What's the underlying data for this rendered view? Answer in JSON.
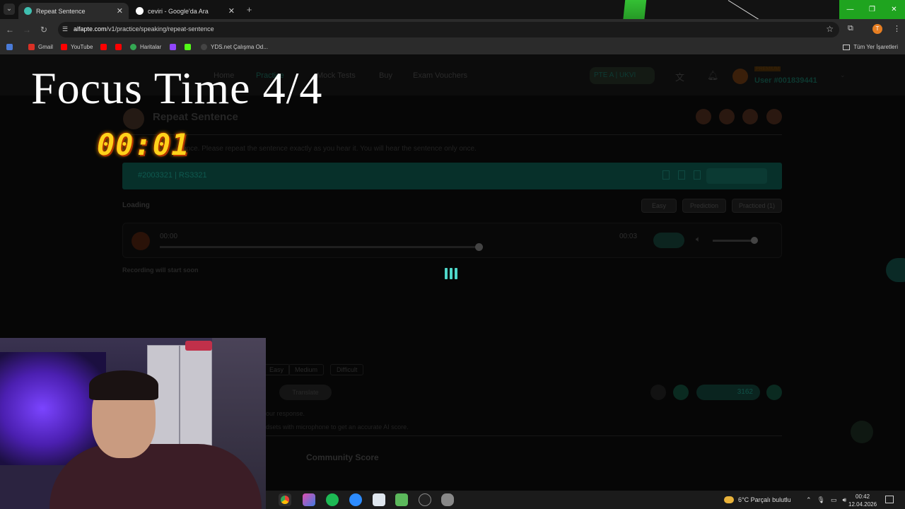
{
  "browser": {
    "tabs": [
      {
        "title": "Repeat Sentence",
        "active": true
      },
      {
        "title": "ceviri - Google'da Ara",
        "active": false
      }
    ],
    "url_host": "alfapte.com",
    "url_path": "/v1/practice/speaking/repeat-sentence",
    "profile_initial": "T",
    "bookmarks": [
      "Gmail",
      "YouTube",
      "Haritalar",
      "YDS.net Çalışma Od..."
    ],
    "all_bookmarks_label": "Tüm Yer İşaretleri"
  },
  "site": {
    "nav": [
      "Home",
      "Practice",
      "Mock Tests",
      "Buy",
      "Exam Vouchers"
    ],
    "exam_selector": "PTE A | UKVI",
    "premium_badge": "PREMIUM",
    "user_label": "User #001839441",
    "section_title": "Repeat Sentence",
    "instructions": "ence. Please repeat the sentence exactly as you hear it. You will hear the sentence only once.",
    "question_id": "#2003321 | RS3321",
    "loading_label": "Loading",
    "chips": {
      "easy": "Easy",
      "prediction": "Prediction",
      "practiced": "Practiced (1)"
    },
    "player": {
      "elapsed": "00:00",
      "duration": "00:03",
      "progress": 1.0,
      "volume": 1.0
    },
    "recording_status": "Recording will start soon",
    "difficulty_options": [
      "Easy",
      "Medium",
      "Difficult"
    ],
    "translate_label": "Translate",
    "hint_1": "our response.",
    "hint_2": "dsets with microphone to get an accurate AI score.",
    "pager_total": "3162",
    "community_score_label": "Community Score"
  },
  "overlay": {
    "focus_title": "Focus Time 4/4",
    "timer": "00:01"
  },
  "taskbar": {
    "weather": "6°C  Parçalı bulutlu",
    "time": "00:42",
    "date": "12.04.2026"
  },
  "colors": {
    "accent": "#4fd7c9",
    "window_controls": "#1fa41f",
    "timer": "#ffd21a"
  }
}
